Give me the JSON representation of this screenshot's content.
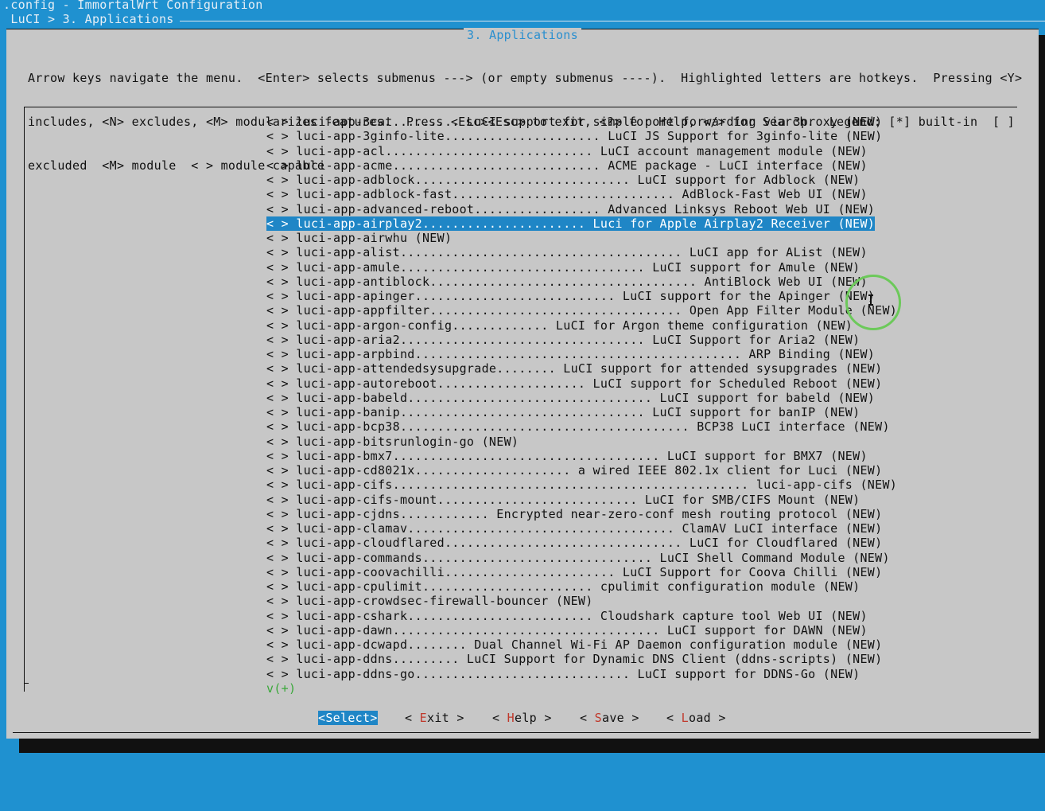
{
  "window": {
    "title": ".config - ImmortalWrt Configuration",
    "breadcrumb": " LuCI > 3. Applications "
  },
  "dialog": {
    "title": "3. Applications",
    "help_lines": [
      "Arrow keys navigate the menu.  <Enter> selects submenus ---> (or empty submenus ----).  Highlighted letters are hotkeys.  Pressing <Y>",
      "includes, <N> excludes, <M> modularizes features.  Press <Esc><Esc> to exit, <?> for Help, </> for Search.  Legend: [*] built-in  [ ]",
      "excluded  <M> module  < > module capable"
    ]
  },
  "menu": {
    "selected_index": 7,
    "items": [
      {
        "prefix": "< > ",
        "label": "luci-app-3cat......... LuCI support for simple port forwarding via 3proxy (NEW)"
      },
      {
        "prefix": "< > ",
        "label": "luci-app-3ginfo-lite..................... LuCI JS Support for 3ginfo-lite (NEW)"
      },
      {
        "prefix": "< > ",
        "label": "luci-app-acl............................ LuCI account management module (NEW)"
      },
      {
        "prefix": "< > ",
        "label": "luci-app-acme............................ ACME package - LuCI interface (NEW)"
      },
      {
        "prefix": "< > ",
        "label": "luci-app-adblock............................. LuCI support for Adblock (NEW)"
      },
      {
        "prefix": "< > ",
        "label": "luci-app-adblock-fast.............................. AdBlock-Fast Web UI (NEW)"
      },
      {
        "prefix": "< > ",
        "label": "luci-app-advanced-reboot................. Advanced Linksys Reboot Web UI (NEW)"
      },
      {
        "prefix": "< > ",
        "label": "luci-app-airplay2...................... Luci for Apple Airplay2 Receiver (NEW)"
      },
      {
        "prefix": "< > ",
        "label": "luci-app-airwhu (NEW)"
      },
      {
        "prefix": "< > ",
        "label": "luci-app-alist...................................... LuCI app for AList (NEW)"
      },
      {
        "prefix": "< > ",
        "label": "luci-app-amule................................. LuCI support for Amule (NEW)"
      },
      {
        "prefix": "< > ",
        "label": "luci-app-antiblock.................................... AntiBlock Web UI (NEW)"
      },
      {
        "prefix": "< > ",
        "label": "luci-app-apinger........................... LuCI support for the Apinger (NEW)"
      },
      {
        "prefix": "< > ",
        "label": "luci-app-appfilter.................................. Open App Filter Module (NEW)"
      },
      {
        "prefix": "< > ",
        "label": "luci-app-argon-config............. LuCI for Argon theme configuration (NEW)"
      },
      {
        "prefix": "< > ",
        "label": "luci-app-aria2................................. LuCI Support for Aria2 (NEW)"
      },
      {
        "prefix": "< > ",
        "label": "luci-app-arpbind............................................ ARP Binding (NEW)"
      },
      {
        "prefix": "< > ",
        "label": "luci-app-attendedsysupgrade........ LuCI support for attended sysupgrades (NEW)"
      },
      {
        "prefix": "< > ",
        "label": "luci-app-autoreboot.................... LuCI support for Scheduled Reboot (NEW)"
      },
      {
        "prefix": "< > ",
        "label": "luci-app-babeld................................. LuCI support for babeld (NEW)"
      },
      {
        "prefix": "< > ",
        "label": "luci-app-banip................................. LuCI support for banIP (NEW)"
      },
      {
        "prefix": "< > ",
        "label": "luci-app-bcp38....................................... BCP38 LuCI interface (NEW)"
      },
      {
        "prefix": "< > ",
        "label": "luci-app-bitsrunlogin-go (NEW)"
      },
      {
        "prefix": "< > ",
        "label": "luci-app-bmx7.................................... LuCI support for BMX7 (NEW)"
      },
      {
        "prefix": "< > ",
        "label": "luci-app-cd8021x..................... a wired IEEE 802.1x client for Luci (NEW)"
      },
      {
        "prefix": "< > ",
        "label": "luci-app-cifs................................................ luci-app-cifs (NEW)"
      },
      {
        "prefix": "< > ",
        "label": "luci-app-cifs-mount........................... LuCI for SMB/CIFS Mount (NEW)"
      },
      {
        "prefix": "< > ",
        "label": "luci-app-cjdns............ Encrypted near-zero-conf mesh routing protocol (NEW)"
      },
      {
        "prefix": "< > ",
        "label": "luci-app-clamav.................................... ClamAV LuCI interface (NEW)"
      },
      {
        "prefix": "< > ",
        "label": "luci-app-cloudflared................................ LuCI for Cloudflared (NEW)"
      },
      {
        "prefix": "< > ",
        "label": "luci-app-commands............................... LuCI Shell Command Module (NEW)"
      },
      {
        "prefix": "< > ",
        "label": "luci-app-coovachilli....................... LuCI Support for Coova Chilli (NEW)"
      },
      {
        "prefix": "< > ",
        "label": "luci-app-cpulimit....................... cpulimit configuration module (NEW)"
      },
      {
        "prefix": "< > ",
        "label": "luci-app-crowdsec-firewall-bouncer (NEW)"
      },
      {
        "prefix": "< > ",
        "label": "luci-app-cshark......................... Cloudshark capture tool Web UI (NEW)"
      },
      {
        "prefix": "< > ",
        "label": "luci-app-dawn.................................... LuCI support for DAWN (NEW)"
      },
      {
        "prefix": "< > ",
        "label": "luci-app-dcwapd........ Dual Channel Wi-Fi AP Daemon configuration module (NEW)"
      },
      {
        "prefix": "< > ",
        "label": "luci-app-ddns......... LuCI Support for Dynamic DNS Client (ddns-scripts) (NEW)"
      },
      {
        "prefix": "< > ",
        "label": "luci-app-ddns-go............................. LuCI support for DDNS-Go (NEW)"
      }
    ],
    "more_indicator": "v(+)"
  },
  "buttons": {
    "select": "<Select>",
    "exit": "< Exit >",
    "help": "< Help >",
    "save": "< Save >",
    "load": "< Load >"
  },
  "colors": {
    "terminal_bg": "#1f91d0",
    "dialog_bg": "#c7c7c7",
    "highlight": "#1f86c6",
    "hotkey": "#c0392b"
  }
}
